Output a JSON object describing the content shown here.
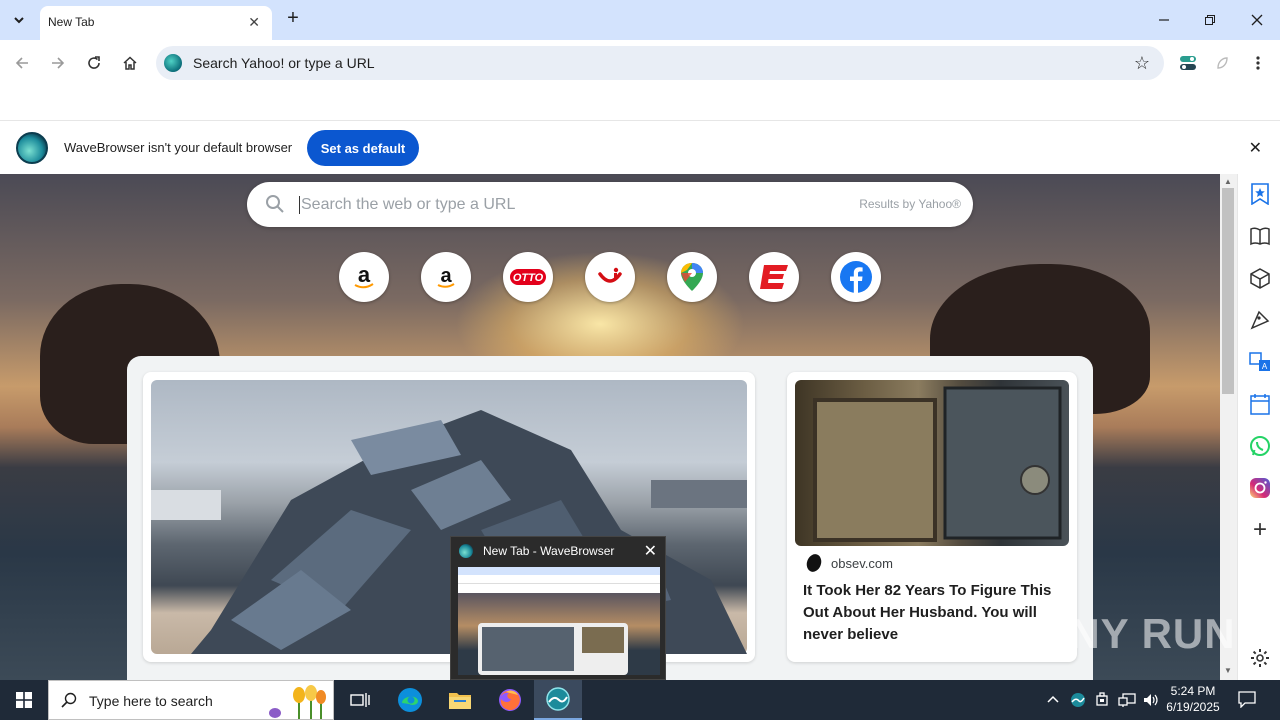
{
  "tab": {
    "title": "New Tab"
  },
  "toolbar": {
    "omnibox_placeholder": "Search Yahoo! or type a URL"
  },
  "infobar": {
    "message": "WaveBrowser isn't your default browser",
    "button_label": "Set as default"
  },
  "newtab": {
    "search_placeholder": "Search the web or type a URL",
    "results_by": "Results by Yahoo®",
    "shortcuts": [
      {
        "name": "amazon-shortcut",
        "icon": "amazon-logo"
      },
      {
        "name": "amazon-shortcut-2",
        "icon": "amazon-logo"
      },
      {
        "name": "otto-shortcut",
        "icon": "otto-logo",
        "label": "OTTO"
      },
      {
        "name": "tui-shortcut",
        "icon": "tui-logo"
      },
      {
        "name": "google-maps-shortcut",
        "icon": "maps-pin"
      },
      {
        "name": "espn-shortcut",
        "icon": "espn-logo"
      },
      {
        "name": "facebook-shortcut",
        "icon": "facebook-logo"
      }
    ],
    "side_article": {
      "source": "obsev.com",
      "title": "It Took Her 82 Years To Figure This Out About Her Husband. You will never believe"
    }
  },
  "preview": {
    "title": "New Tab - WaveBrowser"
  },
  "taskbar": {
    "search_placeholder": "Type here to search",
    "time": "5:24 PM",
    "date": "6/19/2025"
  },
  "watermark": "ANY RUN",
  "colors": {
    "tabstrip": "#d3e3fd",
    "accent_button": "#0b57d0",
    "taskbar": "#1f2a38"
  }
}
